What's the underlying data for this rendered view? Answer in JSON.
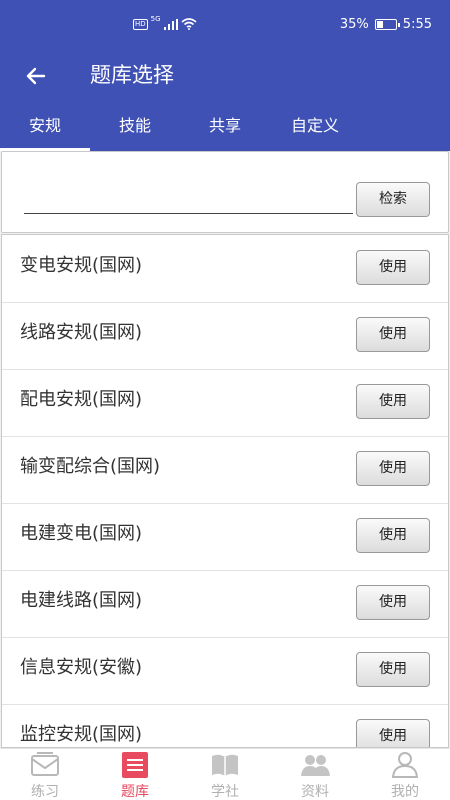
{
  "status_bar": {
    "hd": "HD",
    "network": "5G",
    "battery": "35%",
    "battery_level": 0.35,
    "time": "5:55"
  },
  "app_bar": {
    "back_icon": "back-arrow-icon",
    "title": "题库选择"
  },
  "tabs": [
    {
      "label": "安规",
      "active": true
    },
    {
      "label": "技能",
      "active": false
    },
    {
      "label": "共享",
      "active": false
    },
    {
      "label": "自定义",
      "active": false
    }
  ],
  "search": {
    "value": "",
    "placeholder": "",
    "button_label": "检索"
  },
  "bank_list": {
    "use_label": "使用",
    "items": [
      {
        "label": "变电安规(国网)"
      },
      {
        "label": "线路安规(国网)"
      },
      {
        "label": "配电安规(国网)"
      },
      {
        "label": "输变配综合(国网)"
      },
      {
        "label": "电建变电(国网)"
      },
      {
        "label": "电建线路(国网)"
      },
      {
        "label": "信息安规(安徽)"
      },
      {
        "label": "监控安规(国网)"
      }
    ]
  },
  "bottom_nav": [
    {
      "label": "练习",
      "icon": "mail-icon",
      "active": false
    },
    {
      "label": "题库",
      "icon": "list-icon",
      "active": true
    },
    {
      "label": "学社",
      "icon": "book-icon",
      "active": false
    },
    {
      "label": "资料",
      "icon": "people-icon",
      "active": false
    },
    {
      "label": "我的",
      "icon": "person-icon",
      "active": false
    }
  ],
  "colors": {
    "primary": "#3f51b5",
    "nav_active": "#e84a5f",
    "nav_inactive": "#b0b0b0"
  }
}
